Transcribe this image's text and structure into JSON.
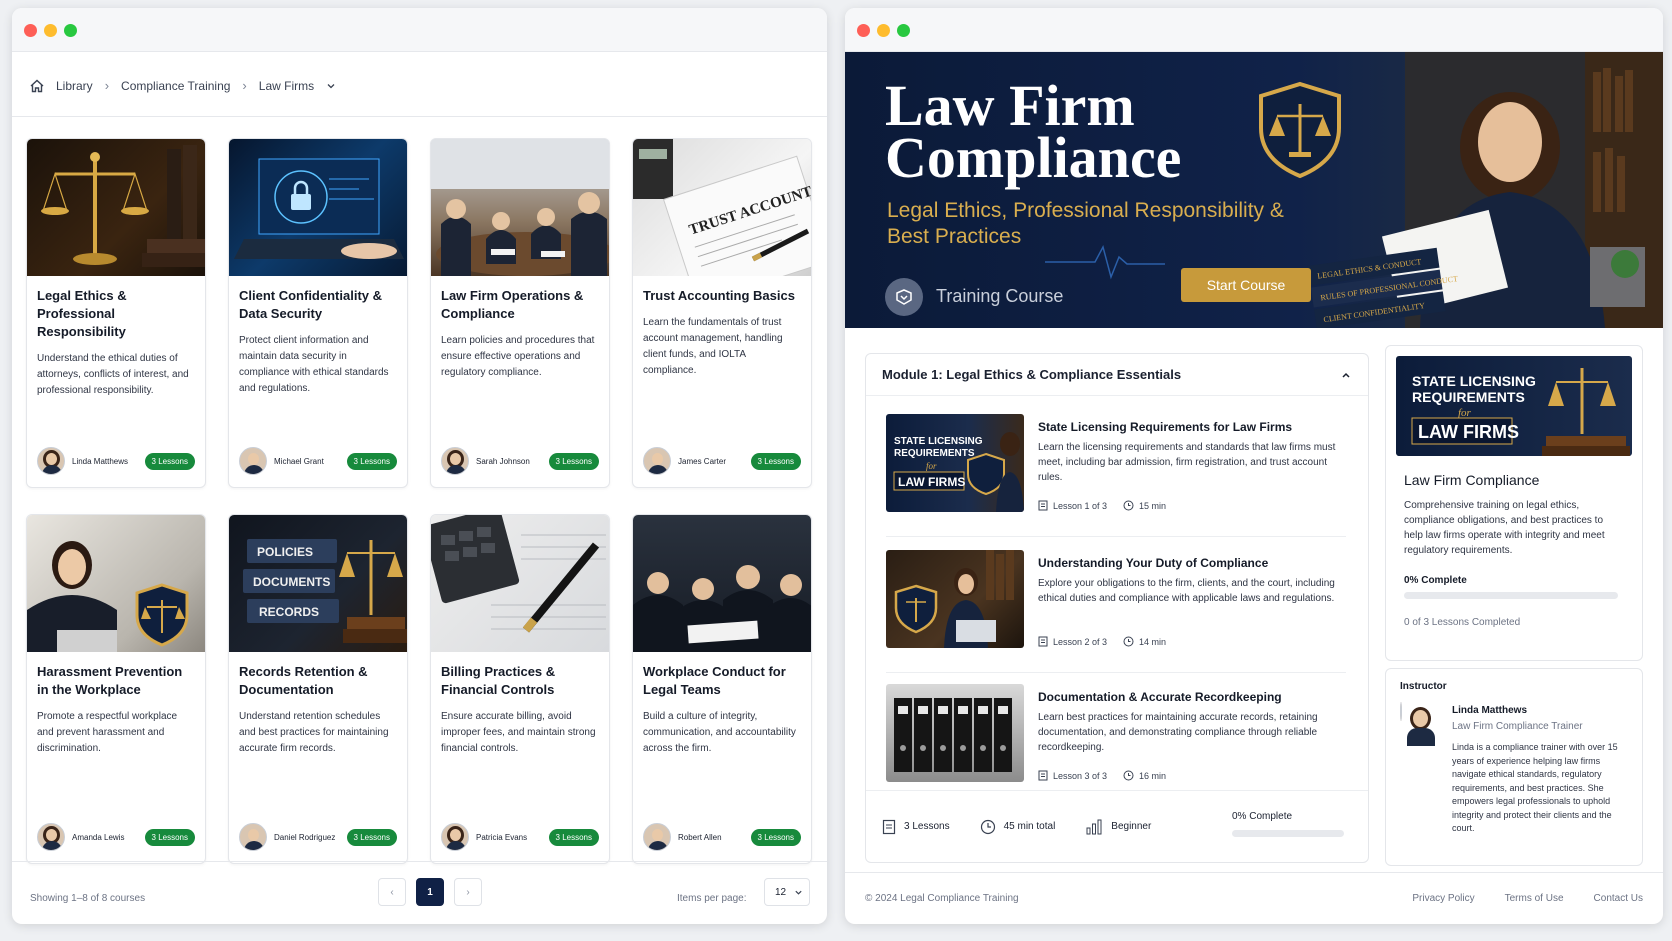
{
  "library": {
    "breadcrumb": [
      "Library",
      "Compliance Training",
      "Law Firms"
    ],
    "courses": [
      {
        "title": "Legal Ethics & Professional Responsibility",
        "desc": "Understand the ethical duties of attorneys, conflicts of interest, and professional responsibility.",
        "author": "Linda Matthews",
        "badge": "3 Lessons",
        "thumb": "scales-of-justice"
      },
      {
        "title": "Client Confidentiality & Data Security",
        "desc": "Protect client information and maintain data security in compliance with ethical standards and regulations.",
        "author": "Michael Grant",
        "badge": "3 Lessons",
        "thumb": "laptop-lock"
      },
      {
        "title": "Law Firm Operations & Compliance",
        "desc": "Learn policies and procedures that ensure effective operations and regulatory compliance.",
        "author": "Sarah Johnson",
        "badge": "3 Lessons",
        "thumb": "meeting"
      },
      {
        "title": "Trust Accounting Basics",
        "desc": "Learn the fundamentals of trust account management, handling client funds, and IOLTA compliance.",
        "author": "James Carter",
        "badge": "3 Lessons",
        "thumb": "trust-account"
      },
      {
        "title": "Harassment Prevention in the Workplace",
        "desc": "Promote a respectful workplace and prevent harassment and discrimination.",
        "author": "Amanda Lewis",
        "badge": "3 Lessons",
        "thumb": "office-woman"
      },
      {
        "title": "Records Retention & Documentation",
        "desc": "Understand retention schedules and best practices for maintaining accurate firm records.",
        "author": "Daniel Rodriguez",
        "badge": "3 Lessons",
        "thumb": "records"
      },
      {
        "title": "Billing Practices & Financial Controls",
        "desc": "Ensure accurate billing, avoid improper fees, and maintain strong financial controls.",
        "author": "Patricia Evans",
        "badge": "3 Lessons",
        "thumb": "calculator"
      },
      {
        "title": "Workplace Conduct for Legal Teams",
        "desc": "Build a culture of integrity, communication, and accountability across the firm.",
        "author": "Robert Allen",
        "badge": "3 Lessons",
        "thumb": "team"
      }
    ],
    "trust_label": "TRUST ACCOUNT",
    "records_labels": [
      "POLICIES",
      "DOCUMENTS",
      "RECORDS"
    ],
    "showing": "Showing 1–8 of 8 courses",
    "page": "1",
    "items_per_page_label": "Items per page:",
    "items_per_page": "12"
  },
  "course": {
    "hero_title": "Law Firm Compliance",
    "hero_subtitle": "Legal Ethics, Professional Responsibility & Best Practices",
    "hero_tag": "Training Course",
    "start_label": "Start Course",
    "book_spines": [
      "LEGAL ETHICS & CONDUCT",
      "RULES OF PROFESSIONAL CONDUCT",
      "CLIENT CONFIDENTIALITY"
    ],
    "module_title": "Module 1: Legal Ethics & Compliance Essentials",
    "lessons": [
      {
        "title": "State Licensing Requirements for Law Firms",
        "desc": "Learn the licensing requirements and standards that law firms must meet, including bar admission, firm registration, and trust account rules.",
        "index": "Lesson 1 of 3",
        "duration": "15 min"
      },
      {
        "title": "Understanding Your Duty of Compliance",
        "desc": "Explore your obligations to the firm, clients, and the court, including ethical duties and compliance with applicable laws and regulations.",
        "index": "Lesson 2 of 3",
        "duration": "14 min"
      },
      {
        "title": "Documentation & Accurate Recordkeeping",
        "desc": "Learn best practices for maintaining accurate records, retaining documentation, and demonstrating compliance through reliable recordkeeping.",
        "index": "Lesson 3 of 3",
        "duration": "16 min"
      }
    ],
    "thumb_text": {
      "line1": "STATE LICENSING",
      "line2": "REQUIREMENTS",
      "line3": "for",
      "line4": "LAW FIRMS"
    },
    "stats": {
      "lessons": "3 Lessons",
      "total": "45 min total",
      "level": "Beginner",
      "complete": "0% Complete"
    },
    "progress_fraction": 0,
    "side": {
      "title": "Law Firm Compliance",
      "desc": "Comprehensive training on legal ethics, compliance obligations, and best practices to help law firms operate with integrity and meet regulatory requirements.",
      "pct": "0% Complete",
      "done": "0 of 3 Lessons Completed"
    },
    "instructor": {
      "heading": "Instructor",
      "name": "Linda Matthews",
      "role": "Law Firm Compliance Trainer",
      "bio": "Linda is a compliance trainer with over 15 years of experience helping law firms navigate ethical standards, regulatory requirements, and best practices. She empowers legal professionals to uphold integrity and protect their clients and the court."
    },
    "footer": {
      "copyright": "© 2024 Legal Compliance Training",
      "links": [
        "Privacy Policy",
        "Terms of Use",
        "Contact Us"
      ]
    }
  },
  "colors": {
    "accent": "#102146",
    "badge_green": "#178a3c",
    "gold": "#c79a3b"
  }
}
